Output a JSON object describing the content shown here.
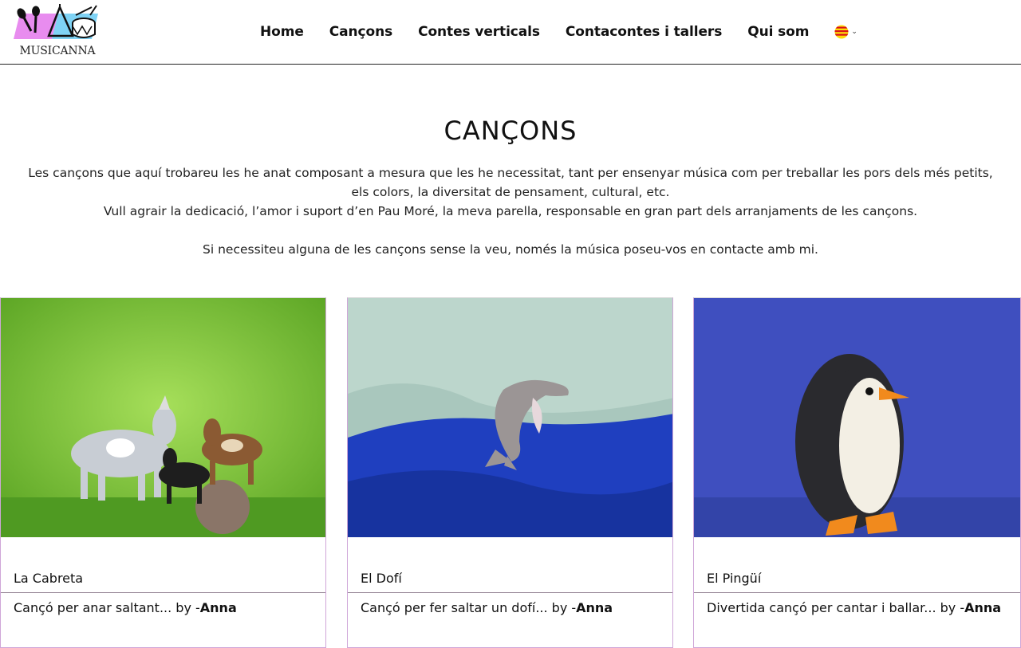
{
  "brand": {
    "logo_text": "MUSICANNA"
  },
  "nav": {
    "items": [
      {
        "label": "Home"
      },
      {
        "label": "Cançons"
      },
      {
        "label": "Contes verticals"
      },
      {
        "label": "Contacontes i tallers"
      },
      {
        "label": "Qui som"
      }
    ],
    "language": {
      "icon": "catalan-flag-icon",
      "chevron": "chevron-down-icon"
    }
  },
  "page": {
    "title": "CANÇONS",
    "intro_lines": [
      "Les cançons que aquí trobareu les he anat composant a mesura que les he necessitat, tant per ensenyar música com per treballar les pors dels més petits,",
      "els colors, la diversitat de pensament, cultural, etc.",
      "Vull agrair la dedicació, l’amor i suport d’en Pau Moré, la meva parella, responsable en gran part dels arranjaments de les cançons.",
      "Si necessiteu alguna de les cançons sense la veu, només la música poseu-vos en contacte amb mi."
    ]
  },
  "songs": [
    {
      "title": "La Cabreta",
      "description": "Cançó per anar saltant... by -",
      "author": "Anna",
      "image": "goats-image"
    },
    {
      "title": "El Dofí",
      "description": "Cançó per fer saltar un dofí... by -",
      "author": "Anna",
      "image": "dolphin-image"
    },
    {
      "title": "El Pingüí",
      "description": "Divertida cançó per cantar i ballar... by -",
      "author": "Anna",
      "image": "penguin-image"
    }
  ],
  "colors": {
    "flag_red": "#da121a",
    "flag_yellow": "#fcdd09",
    "card_border": "#cfa6d8",
    "logo_pink": "#e88cef",
    "logo_blue": "#7fd3f5"
  }
}
